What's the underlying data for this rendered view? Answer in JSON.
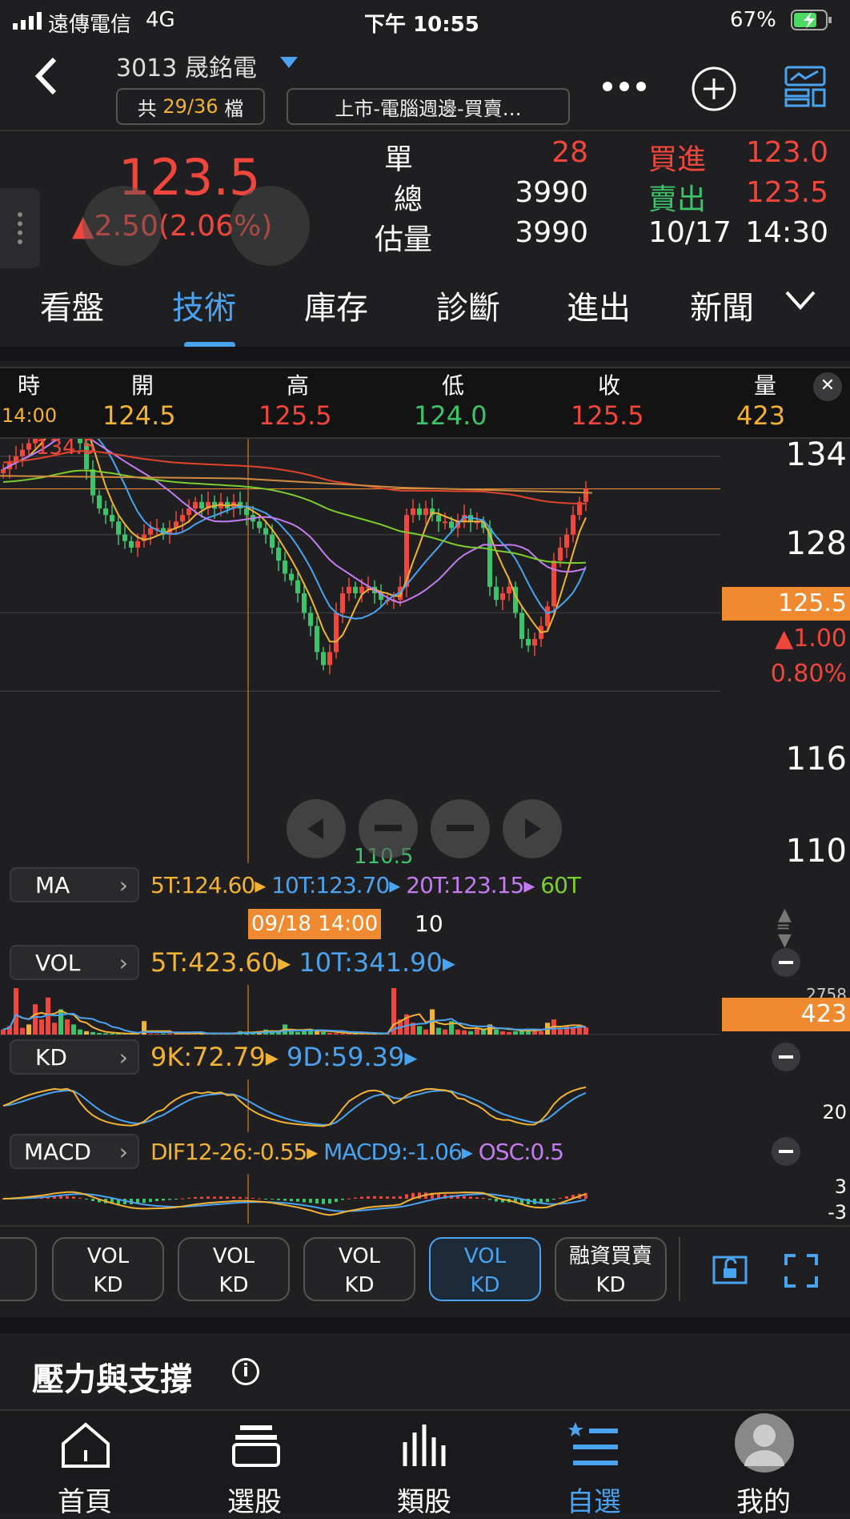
{
  "status": {
    "carrier": "遠傳電信",
    "network": "4G",
    "time": "下午 10:55",
    "battery": "67%"
  },
  "header": {
    "stock": "3013 晟銘電",
    "count_prefix": "共",
    "count": "29/36",
    "count_suffix": "檔",
    "group": "上市-電腦週邊-買賣…"
  },
  "quote": {
    "price": "123.5",
    "change": "▲2.50(2.06%)",
    "rows": [
      {
        "label": "單",
        "value": "28",
        "side_label": "買進",
        "side_value": "123.0"
      },
      {
        "label": "總",
        "value": "3990",
        "side_label": "賣出",
        "side_value": "123.5"
      },
      {
        "label": "估量",
        "value": "3990",
        "side_label": "10/17",
        "side_value": "14:30"
      }
    ]
  },
  "tabs": [
    "看盤",
    "技術",
    "庫存",
    "診斷",
    "進出",
    "新聞"
  ],
  "ohlc": {
    "headers": [
      "時",
      "開",
      "高",
      "低",
      "收",
      "量"
    ],
    "time": "14:00",
    "open": "124.5",
    "high": "125.5",
    "low": "124.0",
    "close": "125.5",
    "volume": "423"
  },
  "chart": {
    "y_labels": [
      "134",
      "128",
      "116",
      "110"
    ],
    "price_tag": "125.5",
    "change_tag": "▲1.00",
    "pct_tag": "0.80%",
    "max_label": "134.5",
    "min_label": "110.5",
    "cursor_date": "09/18 14:00",
    "cursor_extra": "10",
    "vol_max": "2758",
    "vol_tag": "423",
    "kd_label": "20",
    "macd_hi": "3",
    "macd_lo": "-3"
  },
  "indicators": {
    "ma": {
      "name": "MA",
      "v5": "5T:124.60",
      "v10": "10T:123.70",
      "v20": "20T:123.15",
      "v60": "60T"
    },
    "vol": {
      "name": "VOL",
      "v5": "5T:423.60",
      "v10": "10T:341.90"
    },
    "kd": {
      "name": "KD",
      "k": "9K:72.79",
      "d": "9D:59.39"
    },
    "macd": {
      "name": "MACD",
      "dif": "DIF12-26:-0.55",
      "macd": "MACD9:-1.06",
      "osc": "OSC:0.5"
    }
  },
  "bottom_buttons": [
    {
      "l1": "VOL",
      "l2": "KD"
    },
    {
      "l1": "VOL",
      "l2": "KD"
    },
    {
      "l1": "VOL",
      "l2": "KD"
    },
    {
      "l1": "VOL",
      "l2": "KD"
    },
    {
      "l1": "融資買賣",
      "l2": "KD"
    }
  ],
  "section_title": "壓力與支撐",
  "nav": [
    "首頁",
    "選股",
    "類股",
    "自選",
    "我的"
  ],
  "colors": {
    "up": "#f0463c",
    "down": "#3dc46a",
    "accent": "#4aa3f0",
    "orange": "#f08a30"
  },
  "chart_data": {
    "type": "candlestick",
    "ylim": [
      110,
      134
    ],
    "close": [
      127,
      127.5,
      128,
      128.5,
      129,
      129.5,
      130,
      131,
      132,
      131.5,
      132,
      131,
      129,
      127,
      125,
      124,
      123.5,
      123,
      122,
      121.5,
      121,
      121.5,
      122,
      122.5,
      122.5,
      122,
      122.5,
      123,
      123.5,
      124,
      124.5,
      124,
      124.5,
      124,
      124.5,
      124,
      124.5,
      124,
      123.5,
      123,
      122.5,
      122,
      121,
      120,
      119,
      118.5,
      117.5,
      116,
      115,
      113,
      112,
      113,
      116,
      117.5,
      118,
      117.5,
      118,
      118,
      117.5,
      117,
      117,
      117,
      118,
      123.5,
      124,
      123.5,
      124,
      123.5,
      123,
      123,
      122.5,
      123,
      123.5,
      123,
      123,
      122.5,
      118,
      117,
      117.5,
      118,
      116,
      114,
      113.5,
      114,
      115,
      116.5,
      120,
      121,
      122,
      123.5,
      124.5,
      125.5
    ],
    "volume": [
      300,
      500,
      2758,
      400,
      600,
      1800,
      900,
      2200,
      700,
      1500,
      900,
      600,
      300,
      200,
      150,
      100,
      80,
      60,
      50,
      40,
      60,
      40,
      800,
      60,
      50,
      60,
      70,
      50,
      60,
      80,
      100,
      70,
      60,
      50,
      60,
      80,
      120,
      200,
      150,
      100,
      200,
      300,
      250,
      150,
      600,
      200,
      150,
      300,
      250,
      200,
      150,
      100,
      80,
      60,
      90,
      70,
      60,
      50,
      80,
      60,
      70,
      2758,
      900,
      1200,
      700,
      500,
      300,
      1500,
      400,
      300,
      800,
      300,
      250,
      200,
      400,
      350,
      600,
      300,
      200,
      150,
      200,
      300,
      350,
      250,
      200,
      700,
      900,
      300,
      500,
      400,
      600,
      423
    ]
  }
}
